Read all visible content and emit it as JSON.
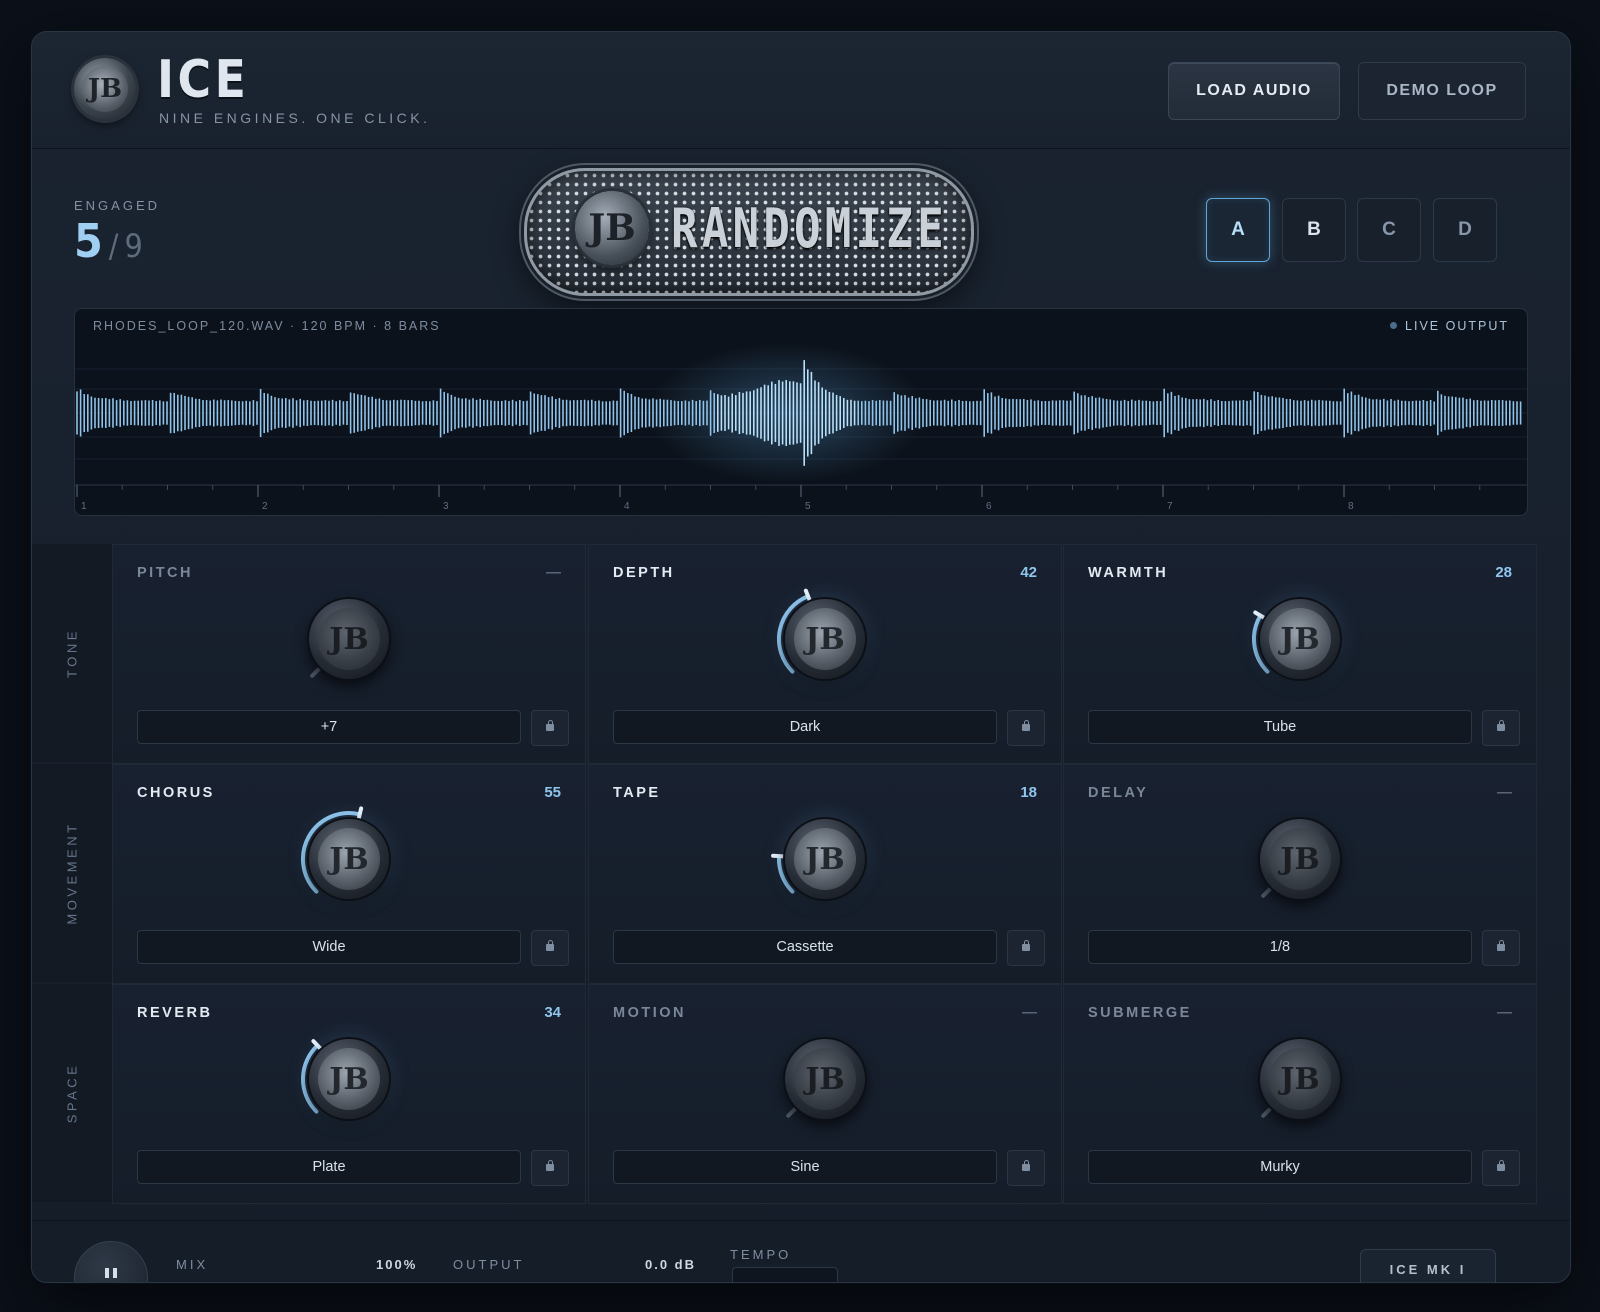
{
  "header": {
    "title": "ICE",
    "subtitle": "NINE ENGINES. ONE CLICK.",
    "logo_letters": "JB",
    "load_label": "LOAD AUDIO",
    "demo_label": "DEMO LOOP"
  },
  "engaged": {
    "label": "ENGAGED",
    "count": "5",
    "separator": "/",
    "total": "9"
  },
  "randomize": {
    "badge": "JB",
    "label": "RANDOMIZE"
  },
  "slots": [
    {
      "label": "A",
      "active": true
    },
    {
      "label": "B",
      "active": false
    },
    {
      "label": "C",
      "active": false
    },
    {
      "label": "D",
      "active": false
    }
  ],
  "waveform": {
    "file_info": "RHODES_LOOP_120.WAV  ·  120 BPM  ·  8 BARS",
    "live_label": "LIVE OUTPUT",
    "bars": [
      "1",
      "2",
      "3",
      "4",
      "5",
      "6",
      "7",
      "8"
    ]
  },
  "rows": [
    {
      "label": "TONE",
      "engines": [
        {
          "name": "PITCH",
          "value": "—",
          "selection": "+7",
          "on": false,
          "amount": 0
        },
        {
          "name": "DEPTH",
          "value": "42",
          "selection": "Dark",
          "on": true,
          "amount": 42
        },
        {
          "name": "WARMTH",
          "value": "28",
          "selection": "Tube",
          "on": true,
          "amount": 28
        }
      ]
    },
    {
      "label": "MOVEMENT",
      "engines": [
        {
          "name": "CHORUS",
          "value": "55",
          "selection": "Wide",
          "on": true,
          "amount": 55
        },
        {
          "name": "TAPE",
          "value": "18",
          "selection": "Cassette",
          "on": true,
          "amount": 18
        },
        {
          "name": "DELAY",
          "value": "—",
          "selection": "1/8",
          "on": false,
          "amount": 0
        }
      ]
    },
    {
      "label": "SPACE",
      "engines": [
        {
          "name": "REVERB",
          "value": "34",
          "selection": "Plate",
          "on": true,
          "amount": 34
        },
        {
          "name": "MOTION",
          "value": "—",
          "selection": "Sine",
          "on": false,
          "amount": 0
        },
        {
          "name": "SUBMERGE",
          "value": "—",
          "selection": "Murky",
          "on": false,
          "amount": 0
        }
      ]
    }
  ],
  "footer": {
    "mix_label": "MIX",
    "mix_value": "100%",
    "output_label": "OUTPUT",
    "output_value": "0.0 dB",
    "tempo_label": "TEMPO",
    "model_label": "ICE MK I"
  },
  "colors": {
    "accent": "#8fc6ee",
    "background": "#0b1019",
    "panel": "#151d29"
  }
}
